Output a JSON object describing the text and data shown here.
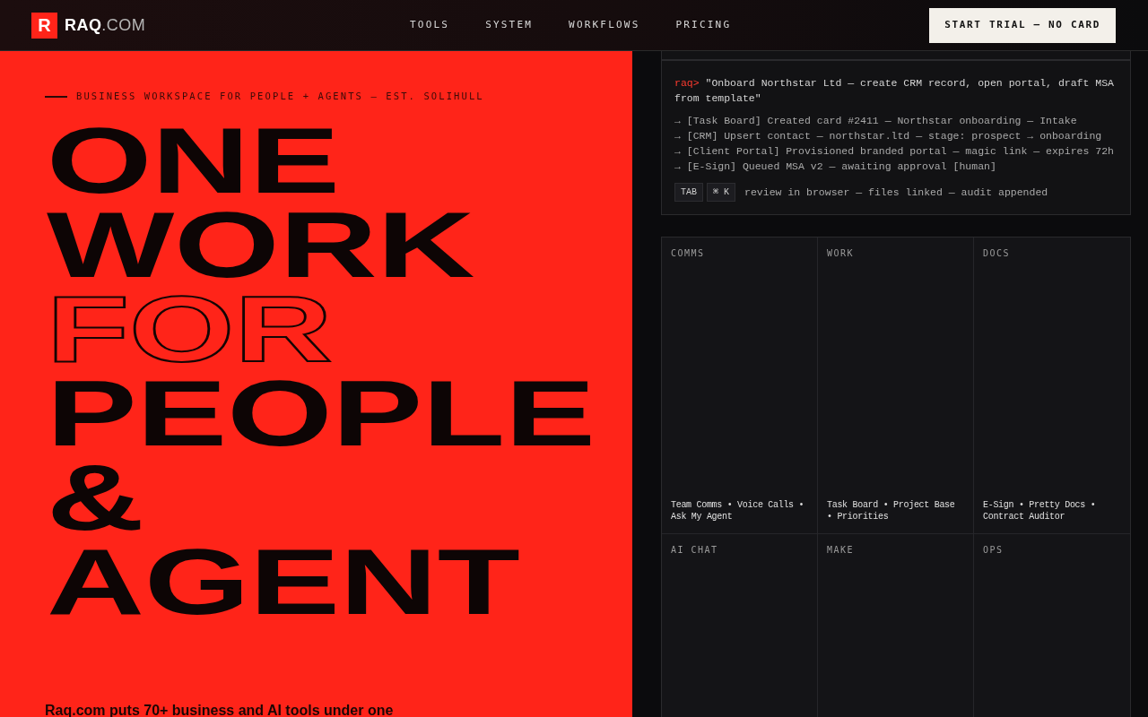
{
  "header": {
    "logo_mark": "R",
    "logo_text": "RAQ",
    "logo_suffix": ".COM",
    "nav": [
      {
        "label": "TOOLS"
      },
      {
        "label": "SYSTEM"
      },
      {
        "label": "WORKFLOWS"
      },
      {
        "label": "PRICING"
      }
    ],
    "cta": "START TRIAL — NO CARD"
  },
  "hero": {
    "eyebrow": "BUSINESS WORKSPACE FOR PEOPLE + AGENTS — EST. SOLIHULL",
    "headline": [
      {
        "text": "ONE",
        "kind": "solid"
      },
      {
        "text": "WORK",
        "kind": "solid"
      },
      {
        "text": "FOR",
        "kind": "outline"
      },
      {
        "text": "PEOPLE",
        "kind": "solid"
      },
      {
        "text": "&",
        "kind": "solid"
      },
      {
        "text": "AGENT",
        "kind": "solid"
      }
    ],
    "intro": "Raq.com puts 70+ business and AI tools under one"
  },
  "terminal": {
    "prompt": "raq>",
    "command": "\"Onboard Northstar Ltd — create CRM record, open portal, draft MSA from template\"",
    "log": [
      "→ [Task Board] Created card #2411 — Northstar onboarding — Intake",
      "→ [CRM] Upsert contact — northstar.ltd — stage: prospect → onboarding",
      "→ [Client Portal] Provisioned branded portal — magic link — expires 72h",
      "→ [E-Sign] Queued MSA v2 — awaiting approval [human]"
    ],
    "keys": [
      "TAB",
      "⌘ K"
    ],
    "hint": "review in browser — files linked — audit appended"
  },
  "modules": [
    {
      "label": "COMMS",
      "tools": "Team Comms • Voice Calls • Ask My Agent"
    },
    {
      "label": "WORK",
      "tools": "Task Board • Project Base • Priorities"
    },
    {
      "label": "DOCS",
      "tools": "E-Sign • Pretty Docs • Contract Auditor"
    },
    {
      "label": "AI CHAT"
    },
    {
      "label": "MAKE"
    },
    {
      "label": "OPS"
    }
  ]
}
